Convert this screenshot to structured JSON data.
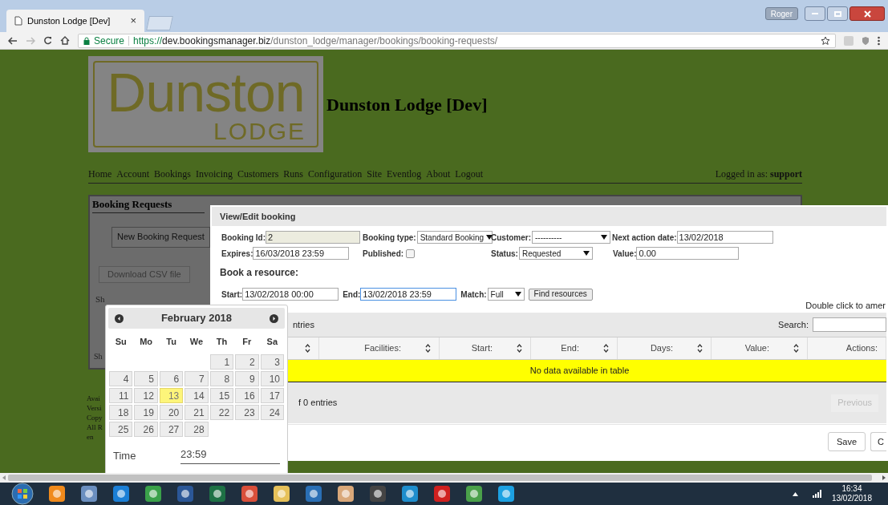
{
  "browser": {
    "tabs": [
      {
        "title": "Dunston Lodge [Dev]",
        "selected": true,
        "close": "×"
      }
    ],
    "user": "Roger",
    "secure_label": "Secure",
    "url": {
      "scheme": "https://",
      "host": "dev.bookingsmanager.biz",
      "path": "/dunston_lodge/manager/bookings/booking-requests/"
    }
  },
  "site": {
    "logo": {
      "word": "Dunston",
      "sub": "LODGE"
    },
    "title": "Dunston Lodge [Dev]",
    "nav": [
      "Home",
      "Account",
      "Bookings",
      "Invoicing",
      "Customers",
      "Runs",
      "Configuration",
      "Site",
      "Eventlog",
      "About",
      "Logout"
    ],
    "logged_in": "Logged in as: **support**",
    "panel": {
      "title": "Booking Requests",
      "new_button": "New Booking Request",
      "csv_button": "Download CSV file",
      "show_fragment": "Sh",
      "show_fragment_2": "Sh"
    },
    "footer": [
      "Avai",
      "Versi",
      "Copy",
      "All R",
      "en"
    ]
  },
  "modal": {
    "title": "View/Edit booking",
    "booking_id": {
      "label": "Booking Id:",
      "value": "2"
    },
    "booking_type": {
      "label": "Booking type:",
      "value": "Standard Booking"
    },
    "customer": {
      "label": "Customer:",
      "value": "----------"
    },
    "next_action": {
      "label": "Next action date:",
      "value": "13/02/2018"
    },
    "expires": {
      "label": "Expires:",
      "value": "16/03/2018 23:59"
    },
    "published": {
      "label": "Published:",
      "checked": false
    },
    "status": {
      "label": "Status:",
      "value": "Requested"
    },
    "value": {
      "label": "Value:",
      "value": "0.00"
    },
    "section": "Book a resource:",
    "start": {
      "label": "Start:",
      "value": "13/02/2018 00:00"
    },
    "end": {
      "label": "End:",
      "value": "13/02/2018 23:59",
      "focused": true
    },
    "match": {
      "label": "Match:",
      "value": "Full"
    },
    "find_button": "Find resources",
    "hint": "Double click to amer",
    "entries_fragment": "ntries",
    "search_label": "Search:",
    "columns": [
      {
        "sortable": true
      },
      {
        "label": "Facilities:",
        "sortable": true
      },
      {
        "label": "Start:",
        "sortable": true
      },
      {
        "label": "End:",
        "sortable": true
      },
      {
        "label": "Days:",
        "sortable": true
      },
      {
        "label": "Value:",
        "sortable": true
      },
      {
        "label": "Actions:",
        "sortable": false
      }
    ],
    "empty_text": "No data available in table",
    "info_fragment": "f 0 entries",
    "previous": {
      "label": "Previous",
      "disabled": true
    },
    "save_button": "Save",
    "cancel_fragment": "C"
  },
  "datepicker": {
    "month": "February 2018",
    "weekdays": [
      "Su",
      "Mo",
      "Tu",
      "We",
      "Th",
      "Fr",
      "Sa"
    ],
    "days": [
      {
        "kind": "blank"
      },
      {
        "kind": "blank"
      },
      {
        "kind": "blank"
      },
      {
        "kind": "blank"
      },
      {
        "kind": "day",
        "label": "1",
        "selected": false
      },
      {
        "kind": "day",
        "label": "2",
        "selected": false
      },
      {
        "kind": "day",
        "label": "3",
        "selected": false
      },
      {
        "kind": "day",
        "label": "4",
        "selected": false
      },
      {
        "kind": "day",
        "label": "5",
        "selected": false
      },
      {
        "kind": "day",
        "label": "6",
        "selected": false
      },
      {
        "kind": "day",
        "label": "7",
        "selected": false
      },
      {
        "kind": "day",
        "label": "8",
        "selected": false
      },
      {
        "kind": "day",
        "label": "9",
        "selected": false
      },
      {
        "kind": "day",
        "label": "10",
        "selected": false
      },
      {
        "kind": "day",
        "label": "11",
        "selected": false
      },
      {
        "kind": "day",
        "label": "12",
        "selected": false
      },
      {
        "kind": "day",
        "label": "13",
        "selected": true
      },
      {
        "kind": "day",
        "label": "14",
        "selected": false
      },
      {
        "kind": "day",
        "label": "15",
        "selected": false
      },
      {
        "kind": "day",
        "label": "16",
        "selected": false
      },
      {
        "kind": "day",
        "label": "17",
        "selected": false
      },
      {
        "kind": "day",
        "label": "18",
        "selected": false
      },
      {
        "kind": "day",
        "label": "19",
        "selected": false
      },
      {
        "kind": "day",
        "label": "20",
        "selected": false
      },
      {
        "kind": "day",
        "label": "21",
        "selected": false
      },
      {
        "kind": "day",
        "label": "22",
        "selected": false
      },
      {
        "kind": "day",
        "label": "23",
        "selected": false
      },
      {
        "kind": "day",
        "label": "24",
        "selected": false
      },
      {
        "kind": "day",
        "label": "25",
        "selected": false
      },
      {
        "kind": "day",
        "label": "26",
        "selected": false
      },
      {
        "kind": "day",
        "label": "27",
        "selected": false
      },
      {
        "kind": "day",
        "label": "28",
        "selected": false
      }
    ],
    "time_label": "Time",
    "time_value": "23:59"
  },
  "taskbar": {
    "time": "16:34",
    "date": "13/02/2018"
  }
}
